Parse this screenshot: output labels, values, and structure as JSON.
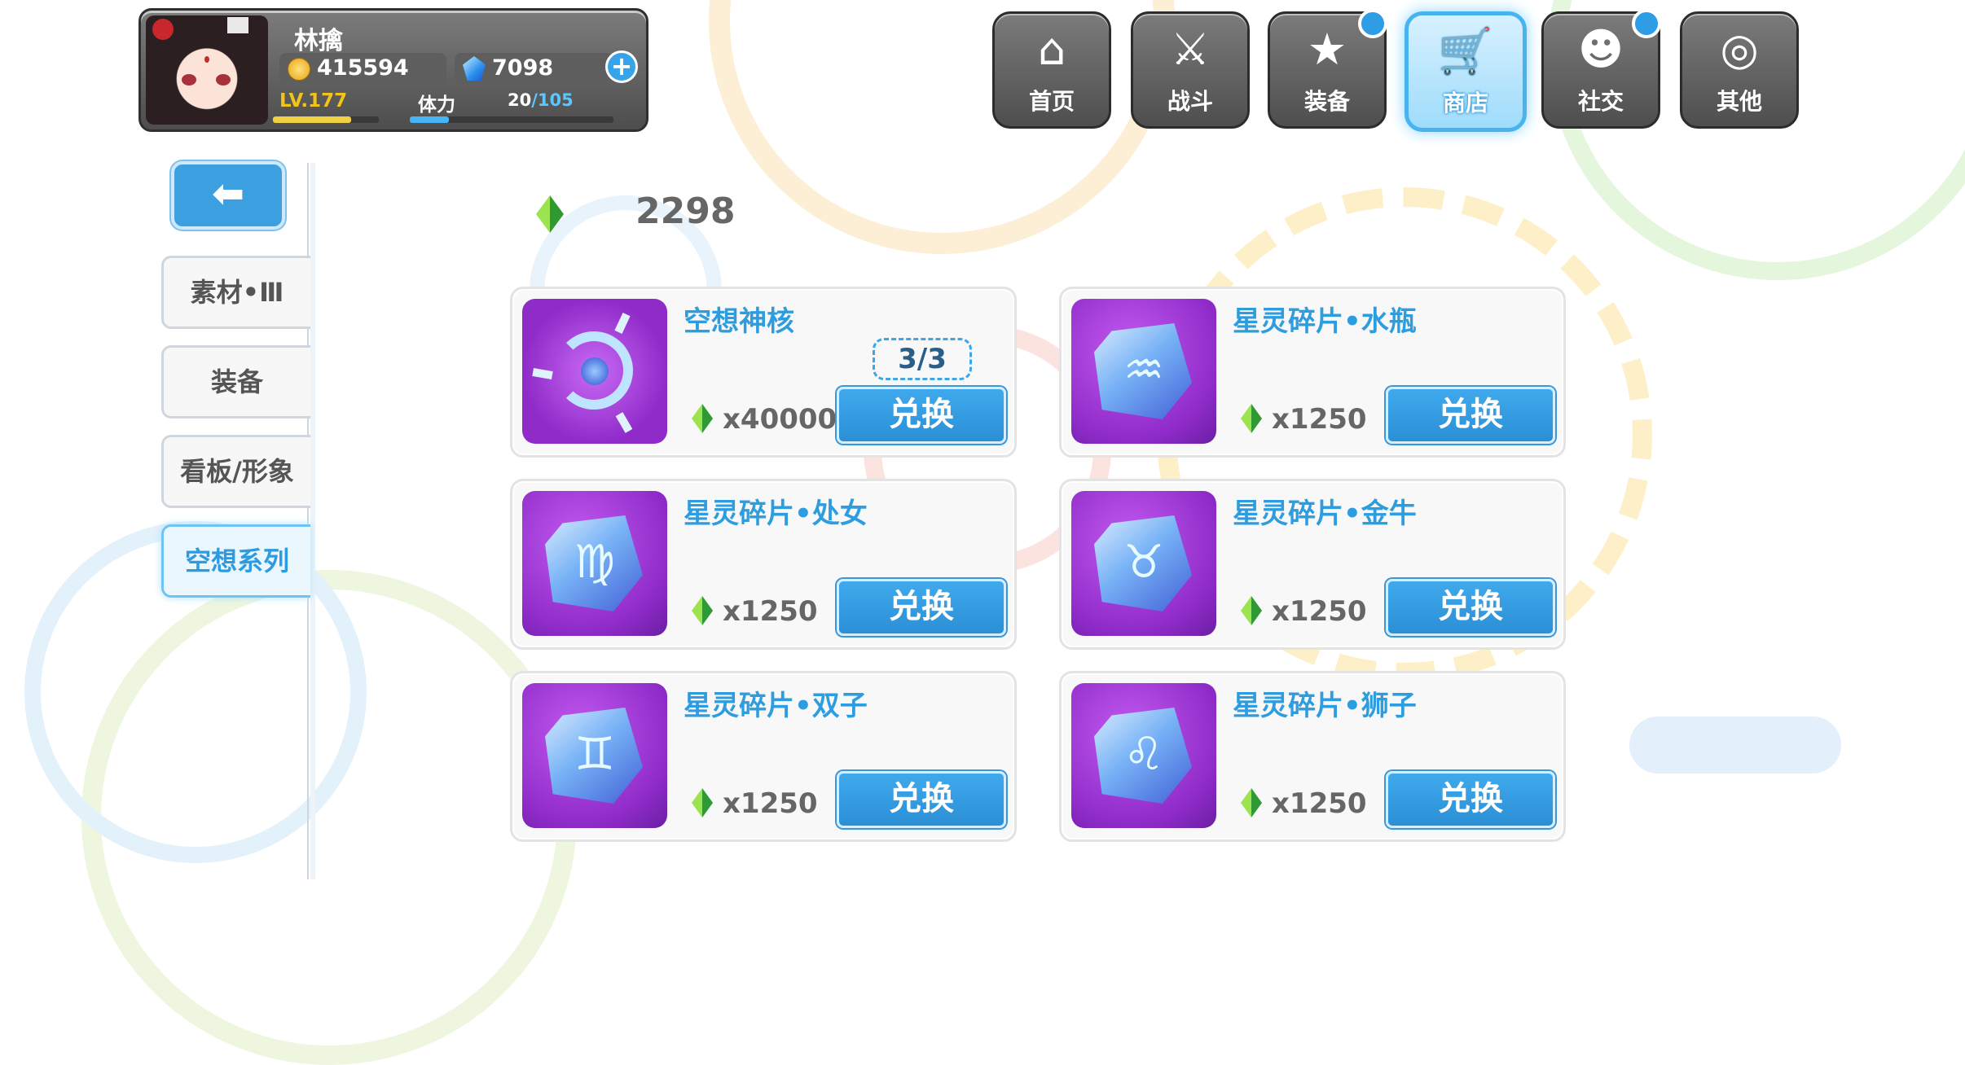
{
  "player": {
    "name": "林擒",
    "coins": "415594",
    "gems": "7098",
    "level_text": "LV.177",
    "stamina_label": "体力",
    "stamina_current": "20",
    "stamina_max": "/105",
    "level_progress": 0.74,
    "stamina_progress": 0.19
  },
  "nav": {
    "items": [
      {
        "label": "首页",
        "icon": "home-icon"
      },
      {
        "label": "战斗",
        "icon": "battle-icon"
      },
      {
        "label": "装备",
        "icon": "equipment-icon",
        "badge": true
      },
      {
        "label": "商店",
        "icon": "shop-icon",
        "active": true
      },
      {
        "label": "社交",
        "icon": "social-icon",
        "badge": true
      },
      {
        "label": "其他",
        "icon": "other-icon"
      }
    ]
  },
  "side": {
    "back_icon": "back-arrow-icon",
    "tabs": [
      {
        "label": "素材•Ⅲ"
      },
      {
        "label": "装备"
      },
      {
        "label": "看板/形象"
      },
      {
        "label": "空想系列",
        "active": true
      }
    ]
  },
  "currency": {
    "icon": "green-crystal-icon",
    "value": "2298"
  },
  "shop": {
    "button_label": "兑换",
    "items": [
      {
        "name": "空想神核",
        "limit": "3/3",
        "price": "x40000",
        "icon": "fantasy-core-icon"
      },
      {
        "name": "星灵碎片•水瓶",
        "price": "x1250",
        "icon": "aquarius-shard-icon",
        "symbol": "♒"
      },
      {
        "name": "星灵碎片•处女",
        "price": "x1250",
        "icon": "virgo-shard-icon",
        "symbol": "♍"
      },
      {
        "name": "星灵碎片•金牛",
        "price": "x1250",
        "icon": "taurus-shard-icon",
        "symbol": "♉"
      },
      {
        "name": "星灵碎片•双子",
        "price": "x1250",
        "icon": "gemini-shard-icon",
        "symbol": "♊"
      },
      {
        "name": "星灵碎片•狮子",
        "price": "x1250",
        "icon": "leo-shard-icon",
        "symbol": "♌"
      }
    ]
  },
  "colors": {
    "accent_blue": "#2e9ddf",
    "gold": "#f2c318",
    "card_bg": "#f8f8f8",
    "icon_purple": "#8f2bc9"
  }
}
